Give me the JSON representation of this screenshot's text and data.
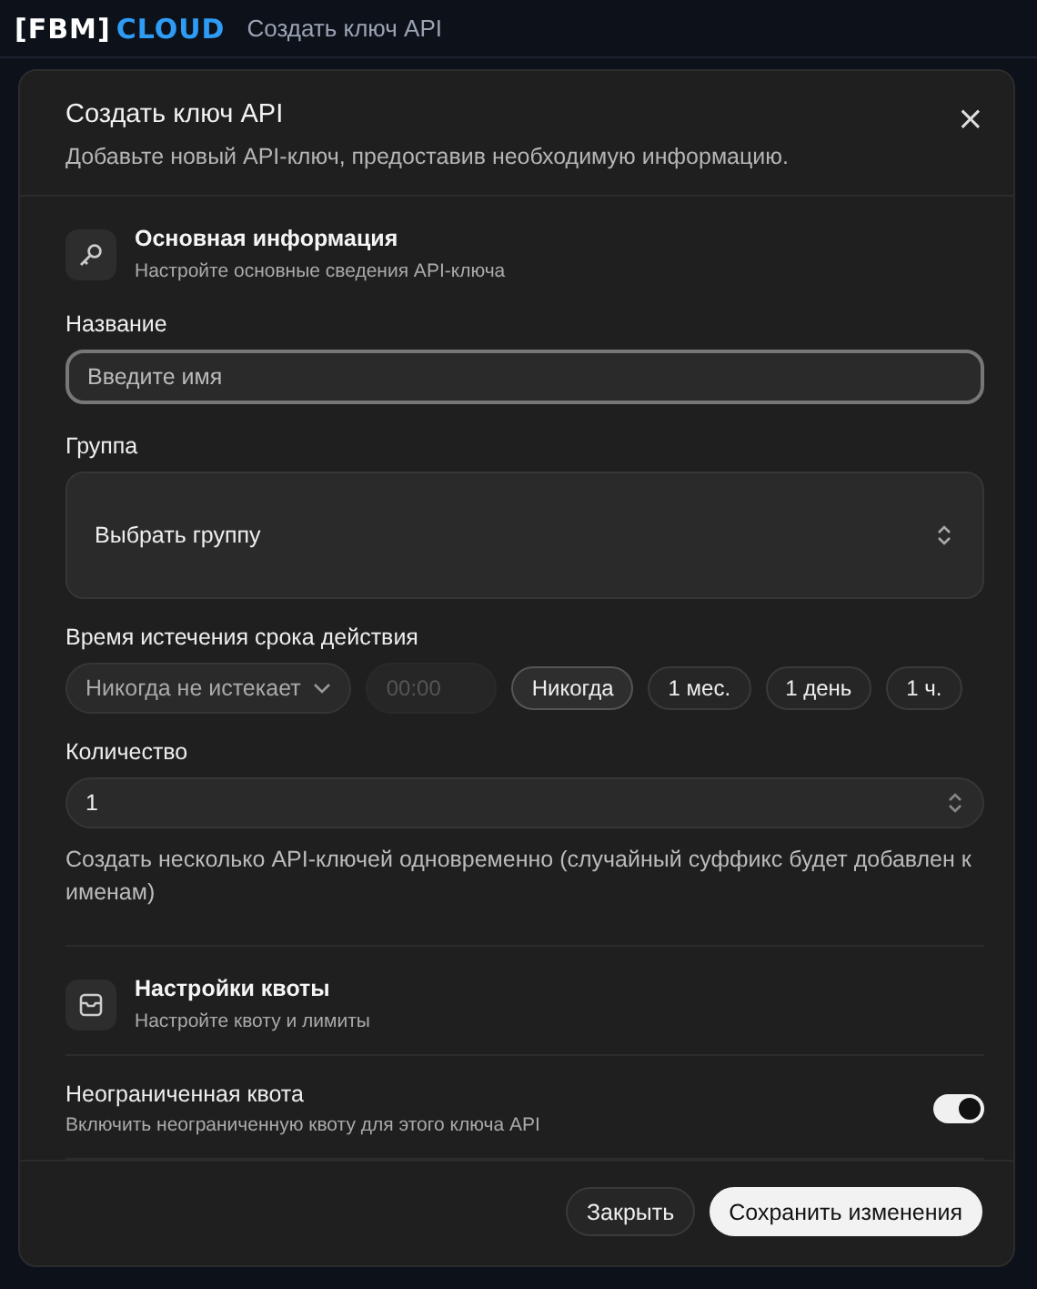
{
  "app": {
    "logo_bracket": "[FBM]",
    "logo_word": "CLOUD",
    "page_title": "Создать ключ API"
  },
  "dialog": {
    "title": "Создать ключ API",
    "subtitle": "Добавьте новый API-ключ, предоставив необходимую информацию.",
    "close": "×"
  },
  "basic_section": {
    "title": "Основная информация",
    "subtitle": "Настройте основные сведения API-ключа"
  },
  "name_field": {
    "label": "Название",
    "placeholder": "Введите имя",
    "focused": true
  },
  "group_field": {
    "label": "Группа",
    "value": "Выбрать группу"
  },
  "expiry": {
    "label": "Время истечения срока действия",
    "select": "Никогда не истекает",
    "time_placeholder": "00:00",
    "time_disabled": true,
    "presets": [
      {
        "label": "Никогда",
        "selected": true
      },
      {
        "label": "1 мес.",
        "selected": false
      },
      {
        "label": "1 день",
        "selected": false
      },
      {
        "label": "1 ч.",
        "selected": false
      }
    ]
  },
  "count_field": {
    "label": "Количество",
    "value": "1",
    "hint": "Создать несколько API-ключей одновременно (случайный суффикс будет добавлен к именам)"
  },
  "quota_section": {
    "title": "Настройки квоты",
    "subtitle": "Настройте квоту и лимиты"
  },
  "unlimited": {
    "label": "Неограниченная квота",
    "description": "Включить неограниченную квоту для этого ключа API",
    "on": true
  },
  "buttons": [
    {
      "label": "Закрыть",
      "kind": "secondary"
    },
    {
      "label": "Сохранить изменения",
      "kind": "primary"
    }
  ]
}
